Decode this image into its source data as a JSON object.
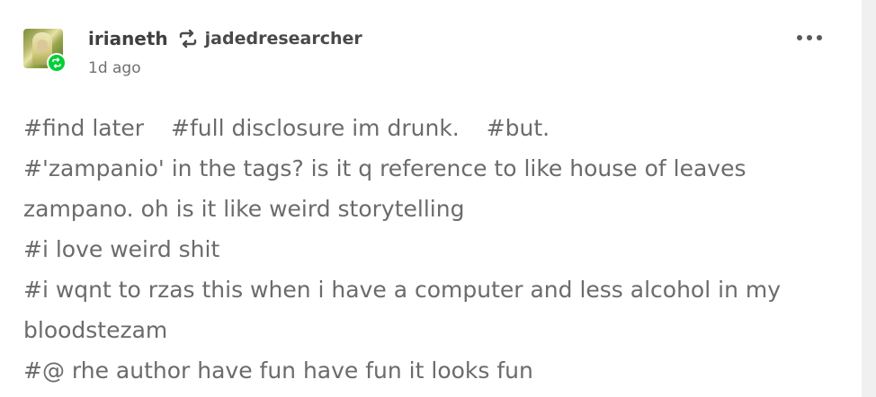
{
  "post": {
    "author": "irianeth",
    "reblogged_from": "jadedresearcher",
    "timestamp": "1d ago",
    "menu_icon": "more-icon",
    "reblog_icon": "reblog-icon",
    "avatar_badge_icon": "reblog-badge-icon",
    "badge_color": "#00cf35",
    "tags_inline": [
      "#find later",
      "#full disclosure im drunk.",
      "#but."
    ],
    "tags": [
      "#'zampanio' in the tags? is it q reference to like house of leaves zampano. oh is it like weird storytelling",
      "#i love weird shit",
      "#i wqnt to rzas this when i have a computer and less alcohol in my bloodstezam",
      "#@ rhe author have fun have fun it looks fun"
    ]
  }
}
